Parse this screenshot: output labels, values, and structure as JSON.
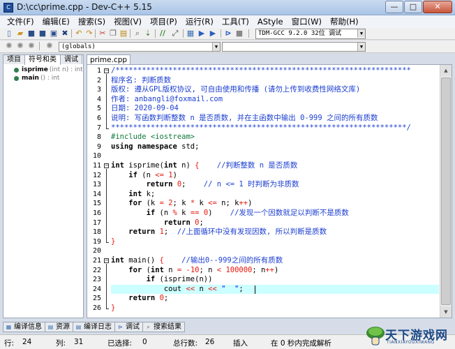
{
  "window": {
    "title": "D:\\cc\\prime.cpp - Dev-C++ 5.15",
    "minimize": "—",
    "maximize": "□",
    "close": "✕",
    "app_icon": "C"
  },
  "menu": [
    "文件(F)",
    "编辑(E)",
    "搜索(S)",
    "视图(V)",
    "项目(P)",
    "运行(R)",
    "工具(T)",
    "AStyle",
    "窗口(W)",
    "帮助(H)"
  ],
  "toolbar": {
    "compiler": "TDM-GCC 9.2.0 32位 调试",
    "scope": "(globals)"
  },
  "left_panel": {
    "tabs": [
      "项目",
      "符号和类",
      "调试"
    ],
    "symbols": [
      {
        "name": "isprime",
        "sig": "(int n) : int"
      },
      {
        "name": "main",
        "sig": "() : int"
      }
    ]
  },
  "editor": {
    "file_tab": "prime.cpp",
    "lines": [
      {
        "n": "1",
        "parts": [
          [
            "c-comment",
            "/*******************************************************************"
          ]
        ]
      },
      {
        "n": "2",
        "parts": [
          [
            "c-comment",
            "程序名: 判断质数"
          ]
        ]
      },
      {
        "n": "3",
        "parts": [
          [
            "c-comment",
            "版权: 遵从GPL版权协议, 可自由使用和传播 (请勿上传到收费性网络文库)"
          ]
        ]
      },
      {
        "n": "4",
        "parts": [
          [
            "c-comment",
            "作者: anbangli@foxmail.com"
          ]
        ]
      },
      {
        "n": "5",
        "parts": [
          [
            "c-comment",
            "日期: 2020-09-04"
          ]
        ]
      },
      {
        "n": "6",
        "parts": [
          [
            "c-comment",
            "说明: 写函数判断整数 n 是否质数, 并在主函数中输出 0-999 之间的所有质数"
          ]
        ]
      },
      {
        "n": "7",
        "parts": [
          [
            "c-comment",
            "*******************************************************************/"
          ]
        ]
      },
      {
        "n": "8",
        "parts": [
          [
            "c-pre",
            "#include <iostream>"
          ]
        ]
      },
      {
        "n": "9",
        "parts": [
          [
            "c-kw",
            "using namespace"
          ],
          [
            "c-text",
            " std;"
          ]
        ]
      },
      {
        "n": "10",
        "parts": []
      },
      {
        "n": "11",
        "parts": [
          [
            "c-kw",
            "int"
          ],
          [
            "c-text",
            " isprime("
          ],
          [
            "c-kw",
            "int"
          ],
          [
            "c-text",
            " n) "
          ],
          [
            "c-op",
            "{"
          ],
          [
            "c-text",
            "    "
          ],
          [
            "c-comment",
            "//判断整数 n 是否质数"
          ]
        ]
      },
      {
        "n": "12",
        "parts": [
          [
            "c-text",
            "    "
          ],
          [
            "c-kw",
            "if"
          ],
          [
            "c-text",
            " (n "
          ],
          [
            "c-op",
            "<="
          ],
          [
            "c-text",
            " "
          ],
          [
            "c-num",
            "1"
          ],
          [
            "c-text",
            ")"
          ]
        ]
      },
      {
        "n": "13",
        "parts": [
          [
            "c-text",
            "        "
          ],
          [
            "c-kw",
            "return"
          ],
          [
            "c-text",
            " "
          ],
          [
            "c-num",
            "0"
          ],
          [
            "c-text",
            ";    "
          ],
          [
            "c-comment",
            "// n <= 1 时判断为非质数"
          ]
        ]
      },
      {
        "n": "14",
        "parts": [
          [
            "c-text",
            "    "
          ],
          [
            "c-kw",
            "int"
          ],
          [
            "c-text",
            " k;"
          ]
        ]
      },
      {
        "n": "15",
        "parts": [
          [
            "c-text",
            "    "
          ],
          [
            "c-kw",
            "for"
          ],
          [
            "c-text",
            " (k "
          ],
          [
            "c-op",
            "="
          ],
          [
            "c-text",
            " "
          ],
          [
            "c-num",
            "2"
          ],
          [
            "c-text",
            "; k "
          ],
          [
            "c-op",
            "*"
          ],
          [
            "c-text",
            " k "
          ],
          [
            "c-op",
            "<="
          ],
          [
            "c-text",
            " n; k"
          ],
          [
            "c-op",
            "++"
          ],
          [
            "c-text",
            ")"
          ]
        ]
      },
      {
        "n": "16",
        "parts": [
          [
            "c-text",
            "        "
          ],
          [
            "c-kw",
            "if"
          ],
          [
            "c-text",
            " (n "
          ],
          [
            "c-op",
            "%"
          ],
          [
            "c-text",
            " k "
          ],
          [
            "c-op",
            "=="
          ],
          [
            "c-text",
            " "
          ],
          [
            "c-num",
            "0"
          ],
          [
            "c-text",
            ")    "
          ],
          [
            "c-comment",
            "//发现一个因数就足以判断不是质数"
          ]
        ]
      },
      {
        "n": "17",
        "parts": [
          [
            "c-text",
            "            "
          ],
          [
            "c-kw",
            "return"
          ],
          [
            "c-text",
            " "
          ],
          [
            "c-num",
            "0"
          ],
          [
            "c-text",
            ";"
          ]
        ]
      },
      {
        "n": "18",
        "parts": [
          [
            "c-text",
            "    "
          ],
          [
            "c-kw",
            "return"
          ],
          [
            "c-text",
            " "
          ],
          [
            "c-num",
            "1"
          ],
          [
            "c-text",
            ";  "
          ],
          [
            "c-comment",
            "//上面循环中没有发现因数, 所以判断是质数"
          ]
        ]
      },
      {
        "n": "19",
        "parts": [
          [
            "c-op",
            "}"
          ]
        ]
      },
      {
        "n": "20",
        "parts": []
      },
      {
        "n": "21",
        "parts": [
          [
            "c-kw",
            "int"
          ],
          [
            "c-text",
            " main() "
          ],
          [
            "c-op",
            "{"
          ],
          [
            "c-text",
            "    "
          ],
          [
            "c-comment",
            "//输出0--999之间的所有质数"
          ]
        ]
      },
      {
        "n": "22",
        "parts": [
          [
            "c-text",
            "    "
          ],
          [
            "c-kw",
            "for"
          ],
          [
            "c-text",
            " ("
          ],
          [
            "c-kw",
            "int"
          ],
          [
            "c-text",
            " n "
          ],
          [
            "c-op",
            "="
          ],
          [
            "c-text",
            " "
          ],
          [
            "c-num",
            "-10"
          ],
          [
            "c-text",
            "; n "
          ],
          [
            "c-op",
            "<"
          ],
          [
            "c-text",
            " "
          ],
          [
            "c-num",
            "100000"
          ],
          [
            "c-text",
            "; n"
          ],
          [
            "c-op",
            "++"
          ],
          [
            "c-text",
            ")"
          ]
        ]
      },
      {
        "n": "23",
        "parts": [
          [
            "c-text",
            "        "
          ],
          [
            "c-kw",
            "if"
          ],
          [
            "c-text",
            " (isprime(n))"
          ]
        ]
      },
      {
        "n": "24",
        "parts": [
          [
            "c-text",
            "            cout "
          ],
          [
            "c-op",
            "<<"
          ],
          [
            "c-text",
            " n "
          ],
          [
            "c-op",
            "<<"
          ],
          [
            "c-text",
            " "
          ],
          [
            "c-str",
            "\"  \""
          ],
          [
            "c-text",
            ";"
          ]
        ]
      },
      {
        "n": "25",
        "parts": [
          [
            "c-text",
            "    "
          ],
          [
            "c-kw",
            "return"
          ],
          [
            "c-text",
            " "
          ],
          [
            "c-num",
            "0"
          ],
          [
            "c-text",
            ";"
          ]
        ]
      },
      {
        "n": "26",
        "parts": [
          [
            "c-op",
            "}"
          ]
        ]
      }
    ],
    "current_line": "24"
  },
  "bottom_tabs": [
    "编译信息",
    "资源",
    "编译日志",
    "调试",
    "搜索结果"
  ],
  "status": {
    "row_label": "行:",
    "row": "24",
    "col_label": "列:",
    "col": "31",
    "sel_label": "已选择:",
    "sel": "0",
    "total_label": "总行数:",
    "total": "26",
    "insert": "插入",
    "parse": "在 0 秒内完成解析"
  },
  "watermark": {
    "title": "天下游戏网",
    "sub": "TIANXIAYOUXIWANG"
  }
}
